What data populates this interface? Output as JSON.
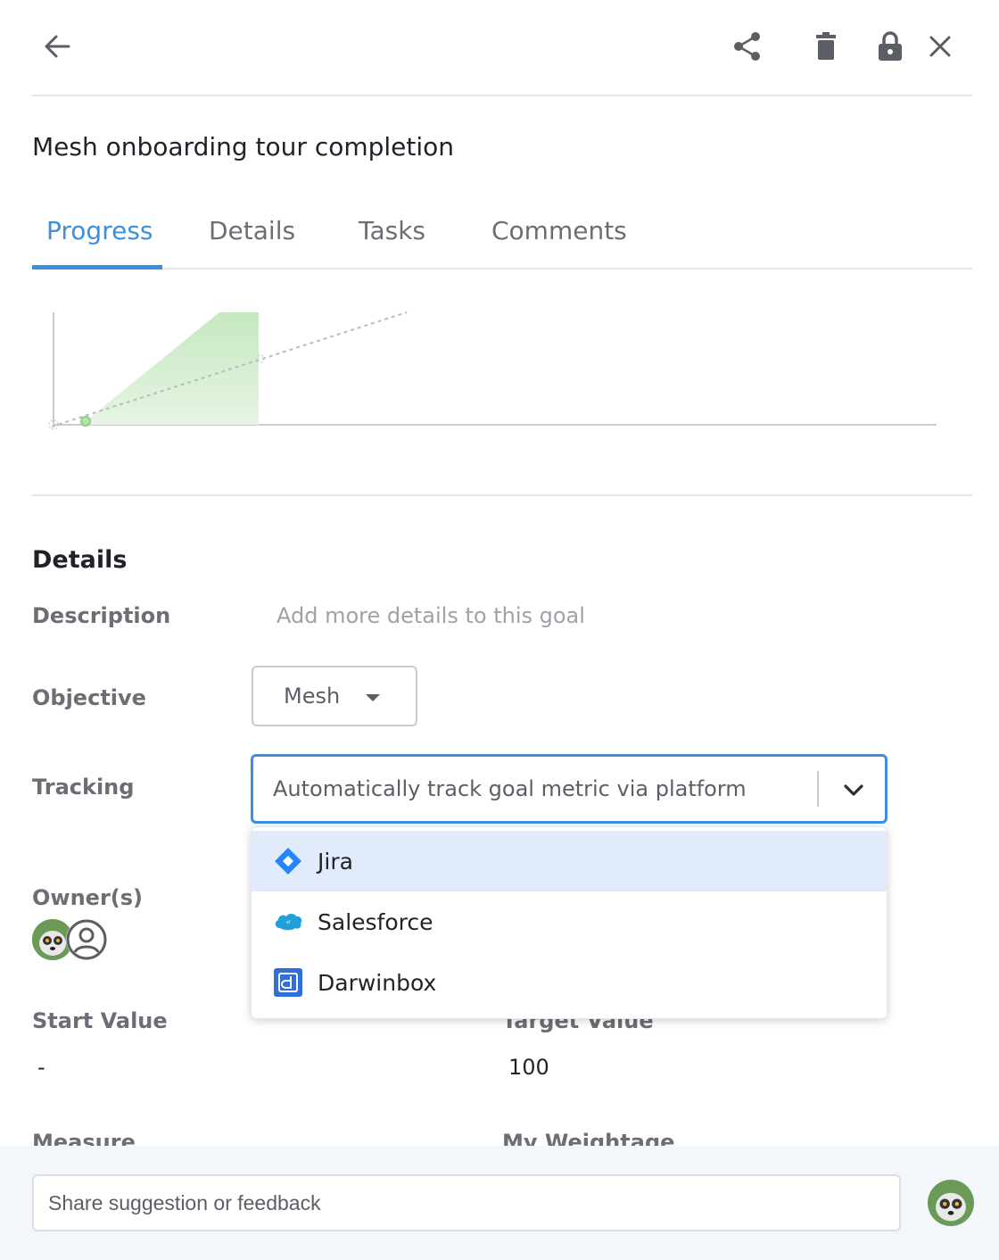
{
  "goal": {
    "title": "Mesh onboarding tour completion"
  },
  "tabs": [
    {
      "label": "Progress",
      "active": true
    },
    {
      "label": "Details",
      "active": false
    },
    {
      "label": "Tasks",
      "active": false
    },
    {
      "label": "Comments",
      "active": false
    }
  ],
  "toolbar": {
    "icons": [
      "back-arrow-icon",
      "share-icon",
      "delete-icon",
      "lock-icon",
      "close-icon"
    ]
  },
  "details": {
    "section_title": "Details",
    "description": {
      "label": "Description",
      "placeholder": "Add more details to this goal"
    },
    "objective": {
      "label": "Objective",
      "value": "Mesh"
    },
    "tracking": {
      "label": "Tracking",
      "value": "Automatically track goal metric via platform",
      "options": [
        {
          "label": "Jira",
          "icon": "jira-icon",
          "highlighted": true
        },
        {
          "label": "Salesforce",
          "icon": "salesforce-icon",
          "highlighted": false
        },
        {
          "label": "Darwinbox",
          "icon": "darwinbox-icon",
          "highlighted": false
        }
      ]
    },
    "owners": {
      "label": "Owner(s)"
    },
    "start_value": {
      "label": "Start Value",
      "value": "-"
    },
    "target_value": {
      "label": "Target Value",
      "value": "100"
    },
    "measure": {
      "label": "Measure"
    },
    "my_weightage": {
      "label": "My Weightage"
    }
  },
  "footer": {
    "feedback_placeholder": "Share suggestion or feedback"
  },
  "colors": {
    "accent": "#3d8fe0",
    "progress_fill": "#cdebc8",
    "highlight": "#e1ebfc"
  }
}
